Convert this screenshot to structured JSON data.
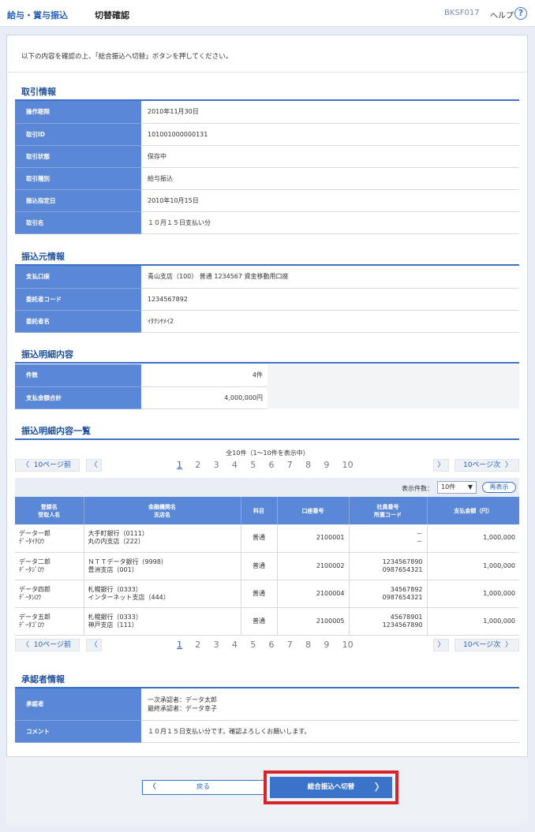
{
  "header": {
    "breadcrumb": "給与・賞与振込",
    "title": "切替確認",
    "screen_code": "BKSF017",
    "help_label": "ヘルプ",
    "help_icon": "?"
  },
  "intro_text": "以下の内容を確認の上、「総合振込へ切替」ボタンを押してください。",
  "transaction": {
    "title": "取引情報",
    "rows": [
      {
        "label": "操作期限",
        "value": "2010年11月30日"
      },
      {
        "label": "取引ID",
        "value": "101001000000131"
      },
      {
        "label": "取引状態",
        "value": "保存中"
      },
      {
        "label": "取引種別",
        "value": "給与振込"
      },
      {
        "label": "振込指定日",
        "value": "2010年10月15日"
      },
      {
        "label": "取引名",
        "value": "１０月１５日支払い分"
      }
    ]
  },
  "source": {
    "title": "振込元情報",
    "rows": [
      {
        "label": "支払口座",
        "value": "青山支店（100） 普通 1234567 資金移動用口座"
      },
      {
        "label": "委託者コード",
        "value": "1234567892"
      },
      {
        "label": "委託者名",
        "value": "ｲﾀｸｼﾔﾒｲ2"
      }
    ]
  },
  "summary": {
    "title": "振込明細内容",
    "rows": [
      {
        "label": "件数",
        "value": "4件"
      },
      {
        "label": "支払金額合計",
        "value": "4,000,000円"
      }
    ]
  },
  "detail_list": {
    "title": "振込明細内容一覧",
    "count_text": "全10件（1～10件を表示中）",
    "pager": {
      "prev10": "10ページ前",
      "prev_arrow": "〈",
      "next_arrow": "〉",
      "next10": "10ページ次",
      "pages": [
        "1",
        "2",
        "3",
        "4",
        "5",
        "6",
        "7",
        "8",
        "9",
        "10"
      ]
    },
    "display_count_label": "表示件数：",
    "display_count_value": "10件",
    "redisplay_label": "再表示",
    "columns": [
      {
        "line1": "登録名",
        "line2": "受取人名"
      },
      {
        "line1": "金融機関名",
        "line2": "支店名"
      },
      {
        "line1": "科目",
        "line2": ""
      },
      {
        "line1": "口座番号",
        "line2": ""
      },
      {
        "line1": "社員番号",
        "line2": "所属コード"
      },
      {
        "line1": "支払金額（円）",
        "line2": ""
      }
    ],
    "rows": [
      {
        "name1": "データ一郎",
        "name2": "ﾃﾞｰﾀｲﾁﾛｳ",
        "bank1": "大手町銀行（0111）",
        "bank2": "丸の内支店（222）",
        "type": "普通",
        "account": "2100001",
        "emp1": "－",
        "emp2": "－",
        "amount": "1,000,000"
      },
      {
        "name1": "データ二郎",
        "name2": "ﾃﾞｰﾀｼﾞﾛｳ",
        "bank1": "ＮＴＴデータ銀行（9998）",
        "bank2": "豊洲支店（001）",
        "type": "普通",
        "account": "2100002",
        "emp1": "1234567890",
        "emp2": "0987654321",
        "amount": "1,000,000"
      },
      {
        "name1": "データ四郎",
        "name2": "ﾃﾞｰﾀｼﾛｳ",
        "bank1": "札幌銀行（0333）",
        "bank2": "インターネット支店（444）",
        "type": "普通",
        "account": "2100004",
        "emp1": "34567892",
        "emp2": "0987654321",
        "amount": "1,000,000"
      },
      {
        "name1": "データ五郎",
        "name2": "ﾃﾞｰﾀｺﾞﾛｳ",
        "bank1": "札幌銀行（0333）",
        "bank2": "神戸支店（111）",
        "type": "普通",
        "account": "2100005",
        "emp1": "45678901",
        "emp2": "1234567890",
        "amount": "1,000,000"
      }
    ]
  },
  "approver": {
    "title": "承認者情報",
    "approver_label": "承認者",
    "approver_line1": "一次承認者：データ太郎",
    "approver_line2": "最終承認者：データ幸子",
    "comment_label": "コメント",
    "comment_value": "１０月１５日支払い分です。確認よろしくお願いします。"
  },
  "actions": {
    "back_label": "戻る",
    "back_arrow": "〈",
    "submit_label": "総合振込へ切替",
    "submit_arrow": "〉"
  },
  "colors": {
    "accent": "#3a73c9",
    "header_cell": "#5b88d6",
    "highlight_frame": "#d8232a"
  }
}
